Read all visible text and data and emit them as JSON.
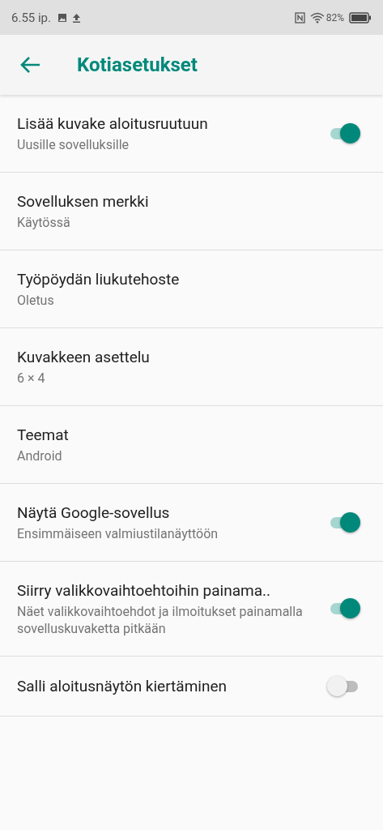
{
  "status_bar": {
    "time": "6.55 ip.",
    "battery": "82%"
  },
  "app_bar": {
    "title": "Kotiasetukset"
  },
  "settings": [
    {
      "kind": "switch",
      "title": "Lisää kuvake aloitusruutuun",
      "subtitle": "Uusille sovelluksille",
      "on": true
    },
    {
      "kind": "plain",
      "title": "Sovelluksen merkki",
      "subtitle": "Käytössä"
    },
    {
      "kind": "plain",
      "title": "Työpöydän liukutehoste",
      "subtitle": "Oletus"
    },
    {
      "kind": "plain",
      "title": "Kuvakkeen asettelu",
      "subtitle": "6 × 4"
    },
    {
      "kind": "plain",
      "title": "Teemat",
      "subtitle": "Android"
    },
    {
      "kind": "switch",
      "title": "Näytä Google-sovellus",
      "subtitle": "Ensimmäiseen valmiustilanäyttöön",
      "on": true
    },
    {
      "kind": "switch",
      "title": "Siirry valikkovaihtoehtoihin painama..",
      "subtitle": "Näet valikkovaihtoehdot ja ilmoitukset painamalla sovelluskuvaketta pitkään",
      "on": true
    },
    {
      "kind": "switch",
      "title": "Salli aloitusnäytön kiertäminen",
      "on": false
    }
  ]
}
